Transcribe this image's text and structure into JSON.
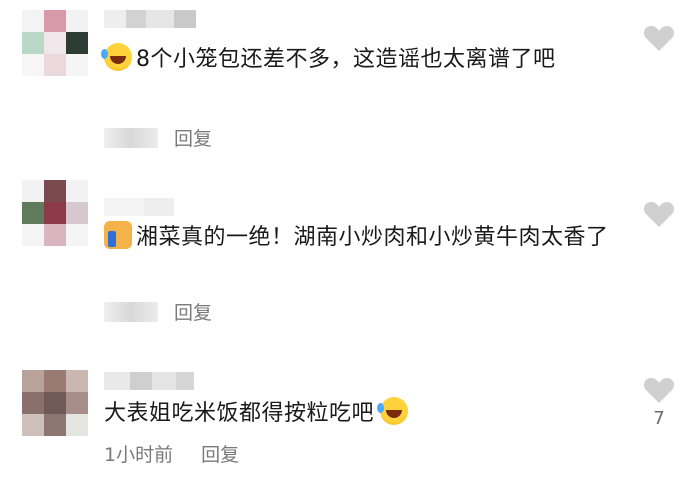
{
  "comments": [
    {
      "text": "8个小笼包还差不多，这造谣也太离谱了吧",
      "emoji": "rolling-laughing-emoji",
      "reply_label": "回复"
    },
    {
      "text": "湘菜真的一绝！湖南小炒肉和小炒黄牛肉太香了",
      "emoji": "thumbs-up-emoji",
      "reply_label": "回复"
    },
    {
      "text": "大表姐吃米饭都得按粒吃吧",
      "emoji": "rolling-laughing-emoji",
      "time": "1小时前",
      "reply_label": "回复",
      "like_count": "7"
    }
  ],
  "colors": {
    "text": "#1a1a1a",
    "meta": "#7a7a7a",
    "heart": "#d0d0d0"
  }
}
